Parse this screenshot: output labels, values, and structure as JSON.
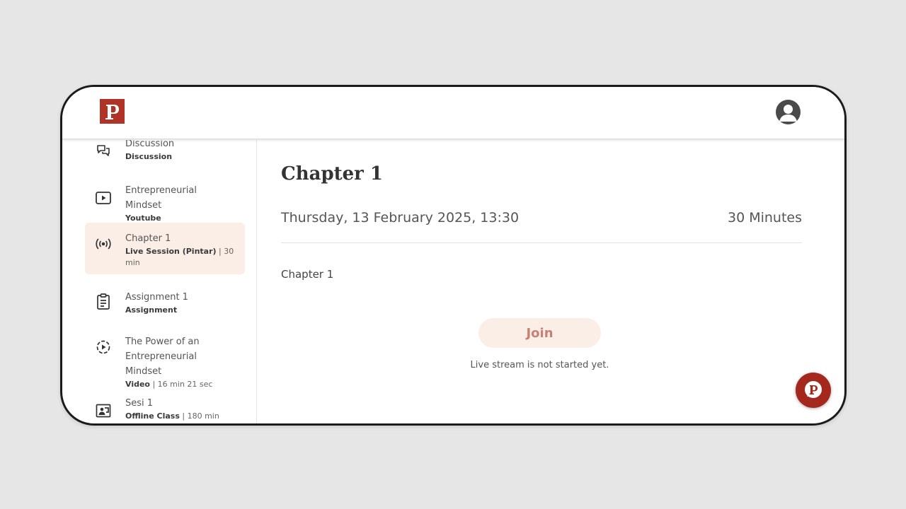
{
  "app": {
    "logo_letter": "P",
    "brand_color": "#b03327",
    "accent_soft": "#fbeee6"
  },
  "header": {
    "logo_icon": "brand-p-logo",
    "avatar_icon": "user-avatar-icon"
  },
  "sidebar": {
    "items": [
      {
        "title": "Discussion",
        "type": "Discussion",
        "meta": "",
        "icon": "chat-bubbles-icon",
        "active": false
      },
      {
        "title": "Entrepreneurial Mindset",
        "type": "Youtube",
        "meta": "",
        "icon": "play-square-icon",
        "active": false
      },
      {
        "title": "Chapter 1",
        "type": "Live Session (Pintar)",
        "meta": " | 30 min",
        "icon": "broadcast-icon",
        "active": true
      },
      {
        "title": "Assignment 1",
        "type": "Assignment",
        "meta": "",
        "icon": "clipboard-icon",
        "active": false
      },
      {
        "title": "The Power of an Entrepreneurial Mindset",
        "type": "Video",
        "meta": " | 16 min 21 sec",
        "icon": "play-circle-dashed-icon",
        "active": false
      },
      {
        "title": "Sesi 1",
        "type": "Offline Class",
        "meta": " | 180 min",
        "icon": "classroom-icon",
        "active": false
      }
    ]
  },
  "main": {
    "title": "Chapter 1",
    "datetime": "Thursday, 13 February 2025, 13:30",
    "duration": "30 Minutes",
    "description": "Chapter 1",
    "join_label": "Join",
    "status": "Live stream is not started yet."
  },
  "chat_fab": {
    "icon": "chat-p-logo-icon"
  }
}
